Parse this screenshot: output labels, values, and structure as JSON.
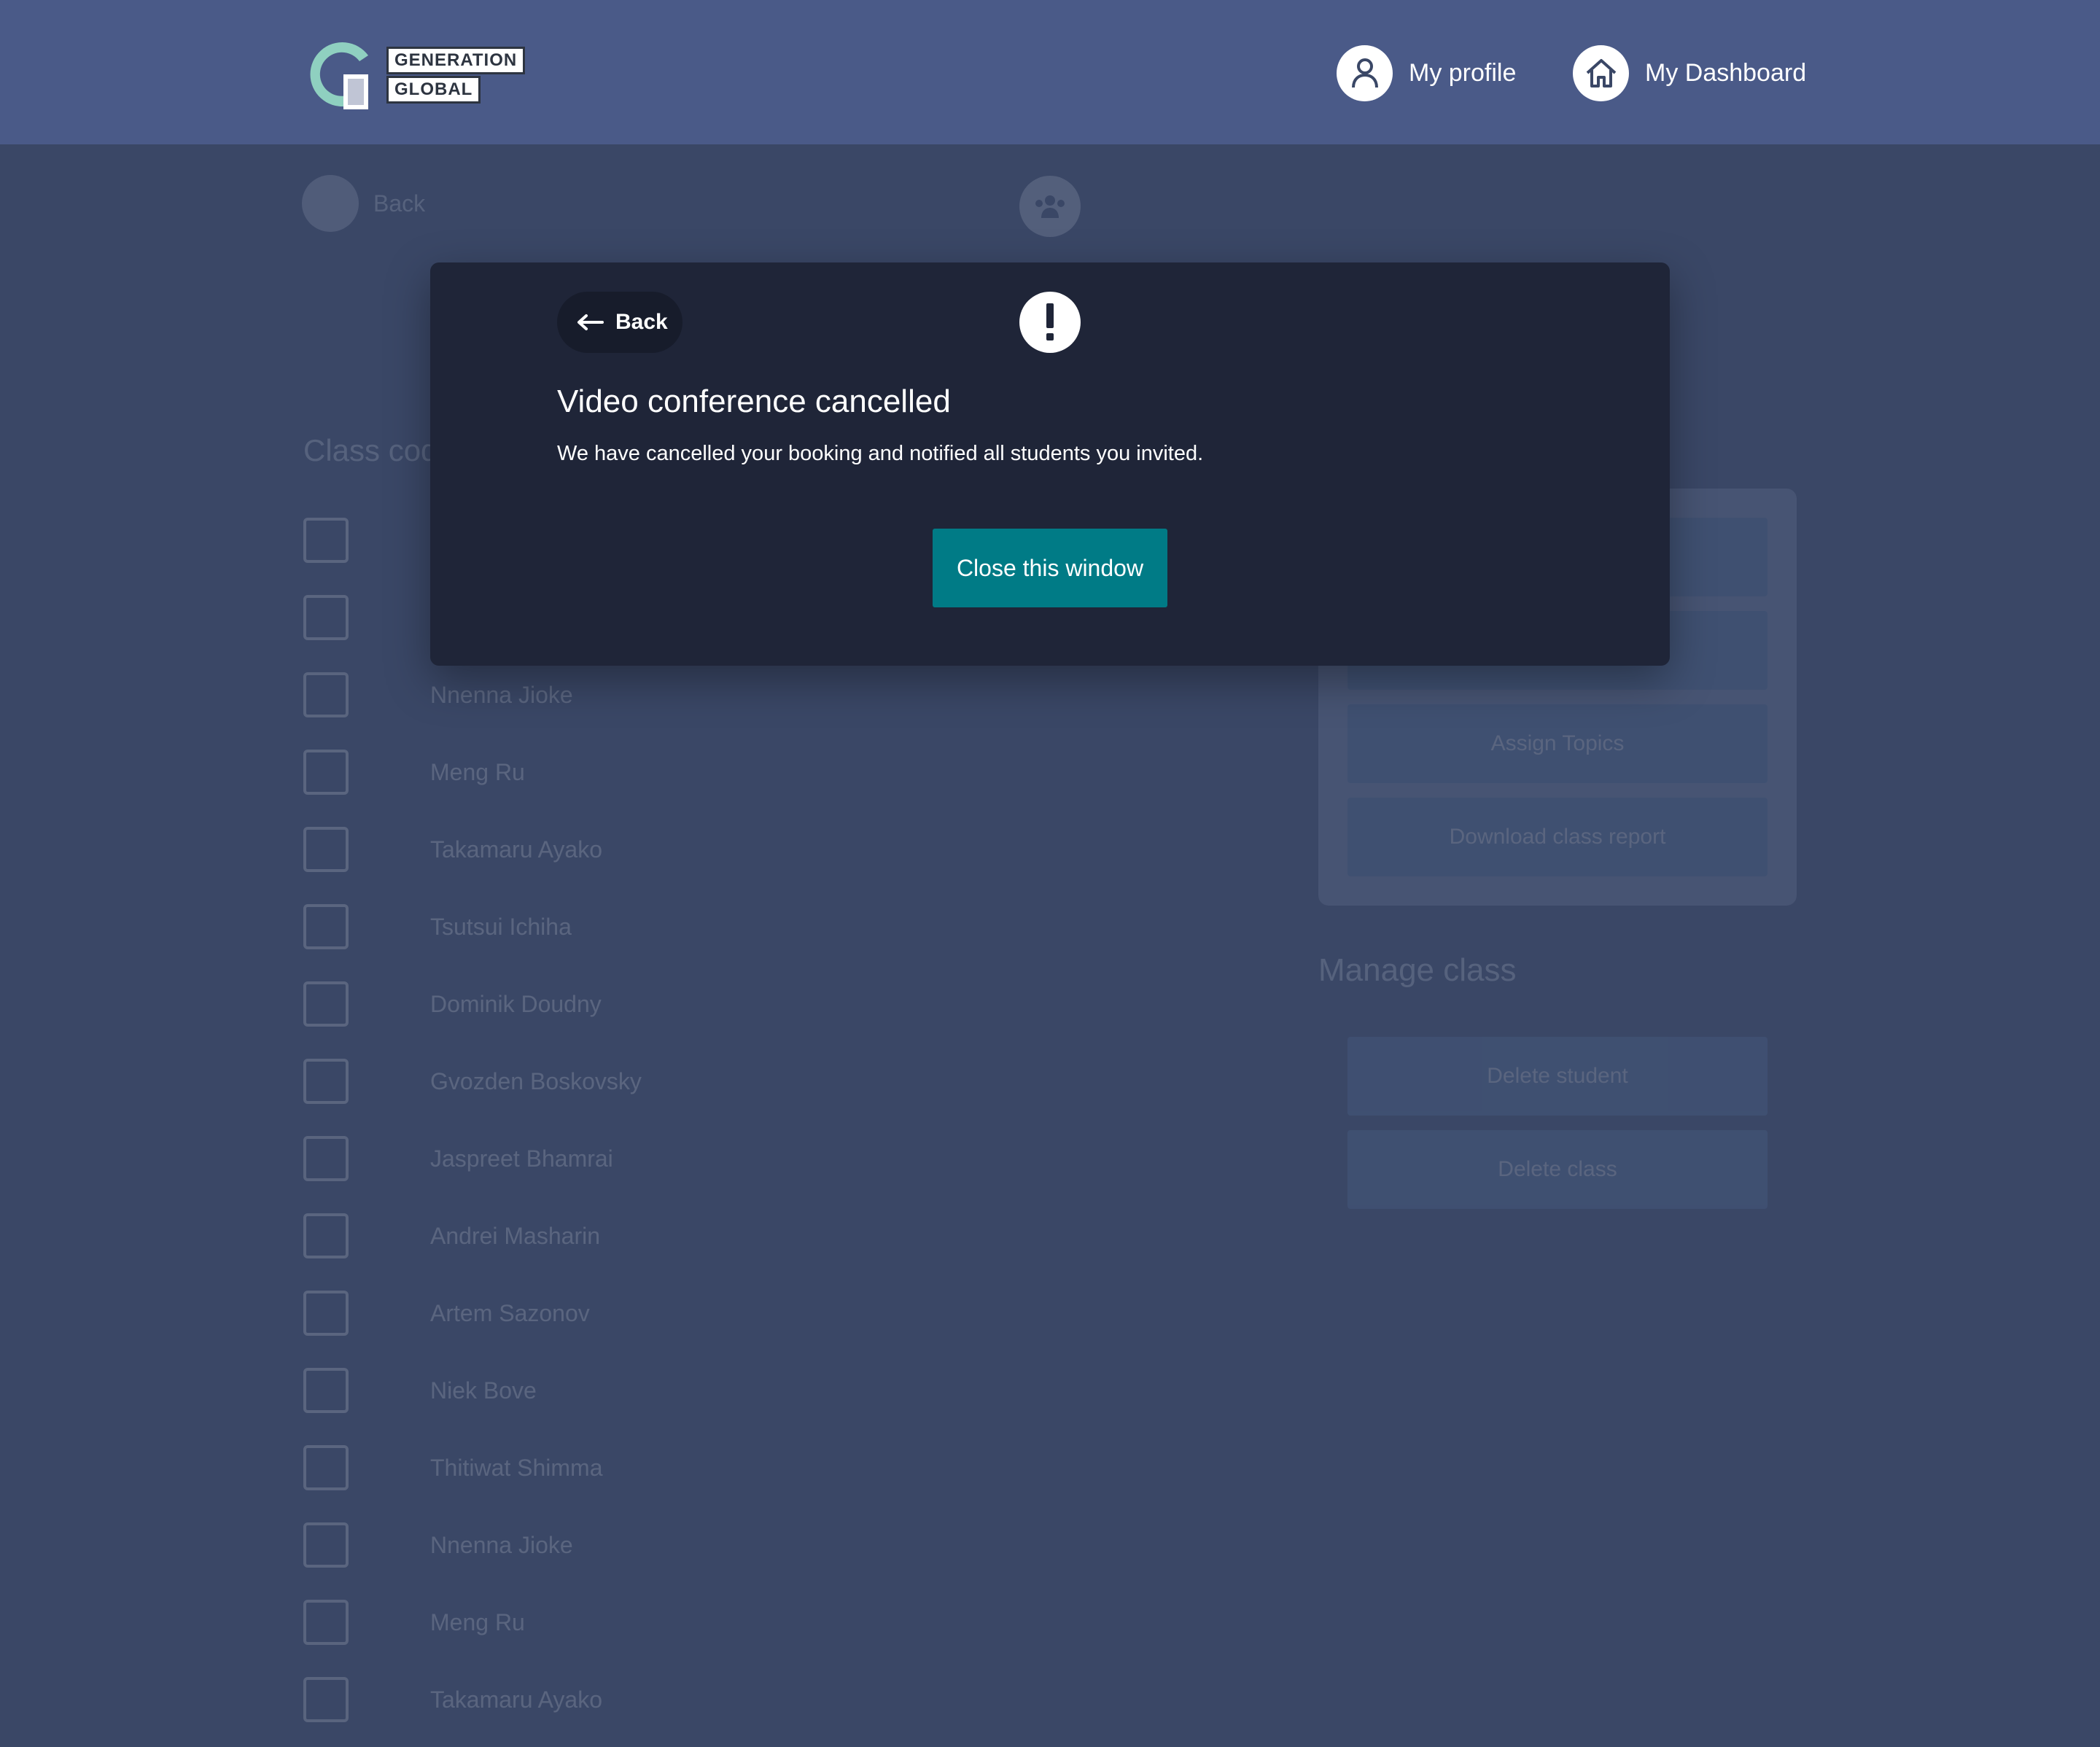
{
  "header": {
    "logo": {
      "line1": "GENERATION",
      "line2": "GLOBAL"
    },
    "nav": {
      "profile_label": "My profile",
      "dashboard_label": "My Dashboard"
    }
  },
  "background_page": {
    "back_label": "Back",
    "class_code_label": "Class cod",
    "students": [
      "",
      "",
      "Nnenna Jioke",
      "Meng Ru",
      "Takamaru Ayako",
      "Tsutsui Ichiha",
      "Dominik Doudny",
      "Gvozden Boskovsky",
      "Jaspreet Bhamrai",
      "Andrei Masharin",
      "Artem Sazonov",
      "Niek Bove",
      "Thitiwat Shimma",
      "Nnenna Jioke",
      "Meng Ru",
      "Takamaru Ayako"
    ],
    "actions": [
      "",
      "",
      "Assign Topics",
      "Download class report"
    ],
    "manage_title": "Manage class",
    "manage_actions": [
      "Delete student",
      "Delete class"
    ]
  },
  "modal": {
    "back_label": "Back",
    "title": "Video conference cancelled",
    "message": "We have cancelled your booking and notified all students you invited.",
    "close_label": "Close this window"
  },
  "colors": {
    "header_bg": "#4a5a88",
    "page_bg": "#3a4766",
    "modal_bg": "#1f2538",
    "primary_button": "#007b86",
    "logo_accent": "#8fd0c0"
  },
  "icons": {
    "profile": "user-icon",
    "dashboard": "home-icon",
    "back": "arrow-left-icon",
    "alert": "exclamation-icon",
    "group": "group-icon"
  }
}
